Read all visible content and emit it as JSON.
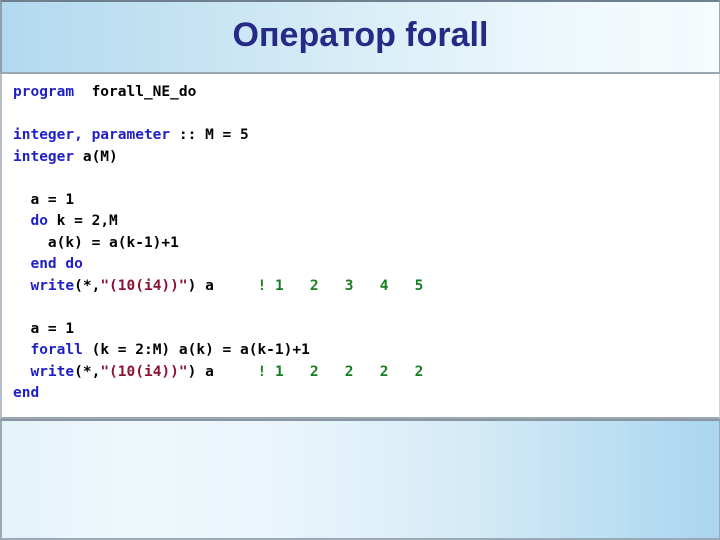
{
  "slide": {
    "title": "Оператор forall",
    "title_color": "#242a86"
  },
  "colors": {
    "keyword": "#1f1fc8",
    "string": "#8d1134",
    "comment": "#177e21",
    "plain": "#000000",
    "header_band_left": "#b3d9ef",
    "header_band_right": "#f6fbfd",
    "bottom_band_left": "#e4f2f9",
    "bottom_band_right": "#a9d6ef",
    "panel_background": "#ffffff"
  },
  "code": {
    "language": "fortran",
    "lines": [
      {
        "id": "line-program",
        "tokens": [
          {
            "t": "program",
            "c": "kw"
          },
          {
            "t": "  forall_NE_do",
            "c": "pln"
          }
        ]
      },
      {
        "id": "line-blank-1",
        "tokens": [
          {
            "t": " ",
            "c": "pln"
          }
        ]
      },
      {
        "id": "line-integer-param",
        "tokens": [
          {
            "t": "integer,",
            "c": "kw"
          },
          {
            "t": " ",
            "c": "pln"
          },
          {
            "t": "parameter",
            "c": "kw"
          },
          {
            "t": " :: M = 5",
            "c": "pln"
          }
        ]
      },
      {
        "id": "line-integer-a",
        "tokens": [
          {
            "t": "integer",
            "c": "kw"
          },
          {
            "t": " a(M)",
            "c": "pln"
          }
        ]
      },
      {
        "id": "line-blank-2",
        "tokens": [
          {
            "t": " ",
            "c": "pln"
          }
        ]
      },
      {
        "id": "line-a-assign-1",
        "tokens": [
          {
            "t": "  a = 1",
            "c": "pln"
          }
        ]
      },
      {
        "id": "line-do",
        "tokens": [
          {
            "t": "  ",
            "c": "pln"
          },
          {
            "t": "do",
            "c": "kw"
          },
          {
            "t": " k = 2,M",
            "c": "pln"
          }
        ]
      },
      {
        "id": "line-do-body",
        "tokens": [
          {
            "t": "    a(k) = a(k-1)+1",
            "c": "pln"
          }
        ]
      },
      {
        "id": "line-end-do",
        "tokens": [
          {
            "t": "  ",
            "c": "pln"
          },
          {
            "t": "end do",
            "c": "kw"
          }
        ]
      },
      {
        "id": "line-write-1",
        "tokens": [
          {
            "t": "  ",
            "c": "pln"
          },
          {
            "t": "write",
            "c": "kw"
          },
          {
            "t": "(*,",
            "c": "pln"
          },
          {
            "t": "\"(10(i4))\"",
            "c": "str"
          },
          {
            "t": ") a     ",
            "c": "pln"
          },
          {
            "t": "! 1   2   3   4   5",
            "c": "cmt"
          }
        ]
      },
      {
        "id": "line-blank-3",
        "tokens": [
          {
            "t": " ",
            "c": "pln"
          }
        ]
      },
      {
        "id": "line-a-assign-2",
        "tokens": [
          {
            "t": "  a = 1",
            "c": "pln"
          }
        ]
      },
      {
        "id": "line-forall",
        "tokens": [
          {
            "t": "  ",
            "c": "pln"
          },
          {
            "t": "forall",
            "c": "kw"
          },
          {
            "t": " (k = 2:M) a(k) = a(k-1)+1",
            "c": "pln"
          }
        ]
      },
      {
        "id": "line-write-2",
        "tokens": [
          {
            "t": "  ",
            "c": "pln"
          },
          {
            "t": "write",
            "c": "kw"
          },
          {
            "t": "(*,",
            "c": "pln"
          },
          {
            "t": "\"(10(i4))\"",
            "c": "str"
          },
          {
            "t": ") a     ",
            "c": "pln"
          },
          {
            "t": "! 1   2   2   2   2",
            "c": "cmt"
          }
        ]
      },
      {
        "id": "line-end",
        "tokens": [
          {
            "t": "end",
            "c": "kw"
          }
        ]
      }
    ]
  }
}
